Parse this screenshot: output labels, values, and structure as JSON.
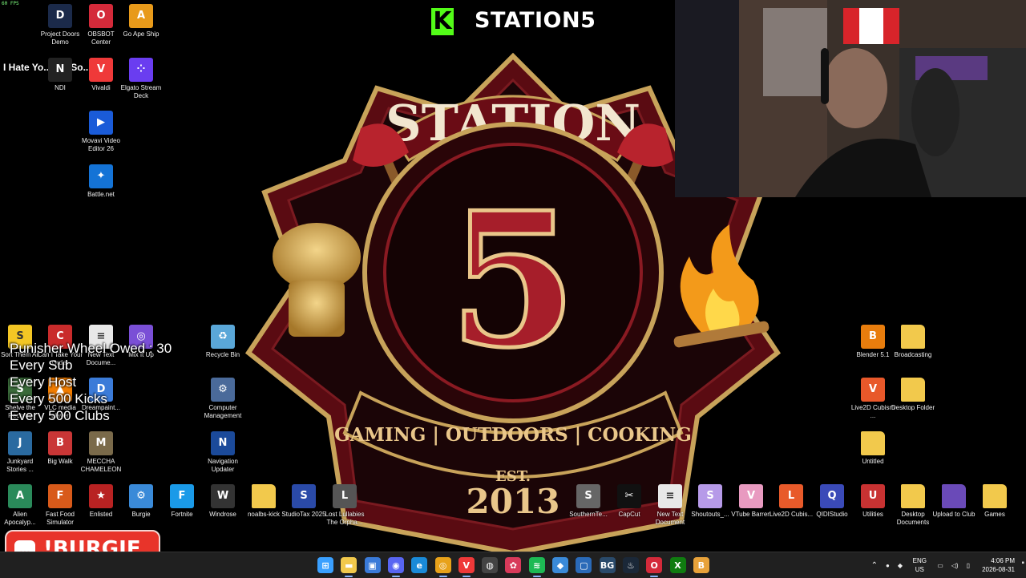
{
  "fps_label": "60 FPS",
  "kick_logo": "K",
  "stream_title": "STATION5",
  "emblem": {
    "top_text": "STATION",
    "number": "5",
    "est": "EST.",
    "motto": "GAMING | OUTDOORS | COOKING",
    "year": "2013"
  },
  "hate_text": "I Hate Yo...ce - So...",
  "overlay": {
    "line1": "Punisher Wheel Owed : 30",
    "line2": "Every Sub",
    "line3": "Every Host",
    "line4": "Every 500 Kicks",
    "line5": "Every 500 Clubs"
  },
  "desktop_icons": [
    {
      "label": "Project Doors Demo",
      "icon": "doors-icon",
      "glyph": "D",
      "color": "#1b2a4a"
    },
    {
      "label": "OBSBOT Center",
      "icon": "obsbot-icon",
      "glyph": "O",
      "color": "#d42a3a"
    },
    {
      "label": "Go Ape Ship",
      "icon": "ape-icon",
      "glyph": "A",
      "color": "#e89a1a"
    },
    {
      "label": "NDI",
      "icon": "ndi-icon",
      "glyph": "N",
      "color": "#222"
    },
    {
      "label": "Vivaldi",
      "icon": "vivaldi-icon",
      "glyph": "V",
      "color": "#ef3939"
    },
    {
      "label": "Elgato Stream Deck",
      "icon": "streamdeck-icon",
      "glyph": "⁘",
      "color": "#6a3df0"
    },
    {
      "label": "Movavi Video Editor 26",
      "icon": "movavi-icon",
      "glyph": "▶",
      "color": "#1a5bd8"
    },
    {
      "label": "Battle.net",
      "icon": "battlenet-icon",
      "glyph": "✦",
      "color": "#1473d6"
    },
    {
      "label": "Sort Them All",
      "icon": "sort-icon",
      "glyph": "S",
      "color": "#f3c624"
    },
    {
      "label": "Can I Take Your Order",
      "icon": "order-icon",
      "glyph": "C",
      "color": "#c92b2b"
    },
    {
      "label": "New Text Docume...",
      "icon": "textdoc-icon",
      "glyph": "≡",
      "color": "#e8e8e8"
    },
    {
      "label": "Mix It Up",
      "icon": "mixitup-icon",
      "glyph": "◎",
      "color": "#7a4fd6"
    },
    {
      "label": "Recycle Bin",
      "icon": "recycle-bin-icon",
      "glyph": "♻",
      "color": "#5aa7d8"
    },
    {
      "label": "Shelve the Records",
      "icon": "shelve-icon",
      "glyph": "S",
      "color": "#3a6a3a"
    },
    {
      "label": "VLC media player",
      "icon": "vlc-icon",
      "glyph": "▲",
      "color": "#f07c00"
    },
    {
      "label": "Dreampaint...",
      "icon": "dreampaint-icon",
      "glyph": "D",
      "color": "#3b7bd8"
    },
    {
      "label": "Computer Management",
      "icon": "computer-icon",
      "glyph": "⚙",
      "color": "#4a6a9a"
    },
    {
      "label": "Junkyard Stories ...",
      "icon": "junkyard-icon",
      "glyph": "J",
      "color": "#2a6aa0"
    },
    {
      "label": "Big Walk",
      "icon": "bigwalk-icon",
      "glyph": "B",
      "color": "#c93636"
    },
    {
      "label": "MECCHA CHAMELEON",
      "icon": "chameleon-icon",
      "glyph": "M",
      "color": "#7a6a4a"
    },
    {
      "label": "Navigation Updater",
      "icon": "navigation-icon",
      "glyph": "N",
      "color": "#1b4a9a"
    },
    {
      "label": "Alien Apocalyp...",
      "icon": "alien-icon",
      "glyph": "A",
      "color": "#2a8a5a"
    },
    {
      "label": "Fast Food Simulator",
      "icon": "fastfood-icon",
      "glyph": "F",
      "color": "#d85a1a"
    },
    {
      "label": "Enlisted",
      "icon": "enlisted-icon",
      "glyph": "★",
      "color": "#b82222"
    },
    {
      "label": "Burgie",
      "icon": "gear-icon",
      "glyph": "⚙",
      "color": "#3a8ad8"
    },
    {
      "label": "Fortnite",
      "icon": "fortnite-icon",
      "glyph": "F",
      "color": "#1a9ae8"
    },
    {
      "label": "Windrose",
      "icon": "windrose-icon",
      "glyph": "W",
      "color": "#333"
    },
    {
      "label": "noalbs-kick",
      "icon": "folder-icon",
      "glyph": "",
      "color": "#f2c94c"
    },
    {
      "label": "StudioTax 2025",
      "icon": "studiotax-icon",
      "glyph": "S",
      "color": "#2a4aa8"
    },
    {
      "label": "Lost Lullabies The Orpha...",
      "icon": "lullabies-icon",
      "glyph": "L",
      "color": "#555"
    },
    {
      "label": "SouthernTe...",
      "icon": "southern-icon",
      "glyph": "S",
      "color": "#666"
    },
    {
      "label": "CapCut",
      "icon": "capcut-icon",
      "glyph": "✂",
      "color": "#111"
    },
    {
      "label": "New Text Document",
      "icon": "textdoc-icon",
      "glyph": "≡",
      "color": "#e8e8e8"
    },
    {
      "label": "Shoutouts_...",
      "icon": "shoutouts-icon",
      "glyph": "S",
      "color": "#b69ae8"
    },
    {
      "label": "VTube Barren",
      "icon": "vtube-icon",
      "glyph": "V",
      "color": "#e89ac0"
    },
    {
      "label": "Live2D Cubis...",
      "icon": "live2d-icon",
      "glyph": "L",
      "color": "#e85a2a"
    },
    {
      "label": "QIDIStudio",
      "icon": "qidi-icon",
      "glyph": "Q",
      "color": "#3a4ab8"
    },
    {
      "label": "Blender 5.1",
      "icon": "blender-icon",
      "glyph": "B",
      "color": "#e87d0d"
    },
    {
      "label": "Broadcasting",
      "icon": "folder-icon",
      "glyph": "",
      "color": "#f2c94c"
    },
    {
      "label": "Live2D Cubism ...",
      "icon": "live2d-icon",
      "glyph": "V",
      "color": "#e8582a"
    },
    {
      "label": "Desktop Folder",
      "icon": "folder-icon",
      "glyph": "",
      "color": "#f2c94c"
    },
    {
      "label": "Untitled",
      "icon": "folder-icon",
      "glyph": "",
      "color": "#f2c94c"
    },
    {
      "label": "Utilities",
      "icon": "utilities-icon",
      "glyph": "U",
      "color": "#c83232"
    },
    {
      "label": "Desktop Documents",
      "icon": "folder-icon",
      "glyph": "",
      "color": "#f2c94c"
    },
    {
      "label": "Upload to Club",
      "icon": "folder-icon",
      "glyph": "",
      "color": "#6a4ab8"
    },
    {
      "label": "Games",
      "icon": "folder-icon",
      "glyph": "",
      "color": "#f2c94c"
    }
  ],
  "chat_badge": {
    "name": "!BURGIE"
  },
  "taskbar": {
    "apps": [
      {
        "name": "start-button",
        "glyph": "⊞",
        "color": "#3aa0ff"
      },
      {
        "name": "file-explorer-icon",
        "glyph": "▬",
        "color": "#f2c94c"
      },
      {
        "name": "store-icon",
        "glyph": "▣",
        "color": "#3a7ad8"
      },
      {
        "name": "discord-icon",
        "glyph": "◉",
        "color": "#5865f2"
      },
      {
        "name": "edge-icon",
        "glyph": "e",
        "color": "#1a8ad8"
      },
      {
        "name": "chrome-icon",
        "glyph": "◎",
        "color": "#e8a21a"
      },
      {
        "name": "vivaldi-icon",
        "glyph": "V",
        "color": "#ef3939"
      },
      {
        "name": "obs-icon",
        "glyph": "◍",
        "color": "#444"
      },
      {
        "name": "app-icon",
        "glyph": "✿",
        "color": "#d83a5a"
      },
      {
        "name": "spotify-icon",
        "glyph": "≋",
        "color": "#1db954"
      },
      {
        "name": "app-icon",
        "glyph": "◆",
        "color": "#3a8ad8"
      },
      {
        "name": "window-icon",
        "glyph": "▢",
        "color": "#2a6ab8"
      },
      {
        "name": "bg-icon",
        "glyph": "BG",
        "color": "#2a4a6a"
      },
      {
        "name": "steam-icon",
        "glyph": "♨",
        "color": "#1b2838"
      },
      {
        "name": "obsbot-icon",
        "glyph": "O",
        "color": "#d42a3a"
      },
      {
        "name": "xbox-icon",
        "glyph": "X",
        "color": "#107c10"
      },
      {
        "name": "burger-icon",
        "glyph": "B",
        "color": "#e8a23a"
      }
    ],
    "lang_top": "ENG",
    "lang_bottom": "US",
    "time": "4:06 PM",
    "date": "2026-08-31"
  }
}
